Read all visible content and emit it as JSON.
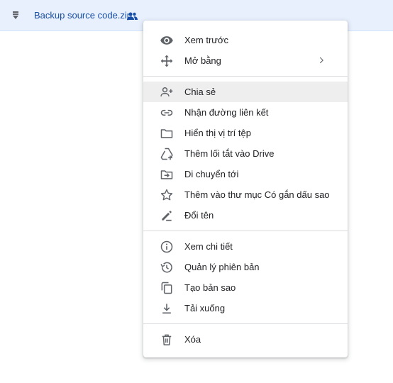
{
  "file_row": {
    "file_type_icon": "zip-file-icon",
    "name": "Backup source code.zip",
    "shared_icon": "people-icon"
  },
  "menu": {
    "groups": [
      [
        {
          "icon": "eye-icon",
          "label": "Xem trước"
        },
        {
          "icon": "move-arrows-icon",
          "label": "Mở bằng",
          "submenu": true
        }
      ],
      [
        {
          "icon": "person-add-icon",
          "label": "Chia sẻ",
          "hovered": true
        },
        {
          "icon": "link-icon",
          "label": "Nhận đường liên kết"
        },
        {
          "icon": "folder-icon",
          "label": "Hiển thị vị trí tệp"
        },
        {
          "icon": "add-to-drive-icon",
          "label": "Thêm lối tắt vào Drive"
        },
        {
          "icon": "move-to-folder-icon",
          "label": "Di chuyển tới"
        },
        {
          "icon": "star-icon",
          "label": "Thêm vào thư mục Có gắn dấu sao"
        },
        {
          "icon": "rename-pencil-icon",
          "label": "Đổi tên"
        }
      ],
      [
        {
          "icon": "info-icon",
          "label": "Xem chi tiết"
        },
        {
          "icon": "history-icon",
          "label": "Quản lý phiên bản"
        },
        {
          "icon": "copy-icon",
          "label": "Tạo bản sao"
        },
        {
          "icon": "download-icon",
          "label": "Tải xuống"
        }
      ],
      [
        {
          "icon": "trash-icon",
          "label": "Xóa"
        }
      ]
    ]
  },
  "colors": {
    "selection_background": "#e8f0fe",
    "file_name_text": "#174ea6",
    "hover_background": "#eeeeee",
    "icon_gray": "#5f6368"
  }
}
